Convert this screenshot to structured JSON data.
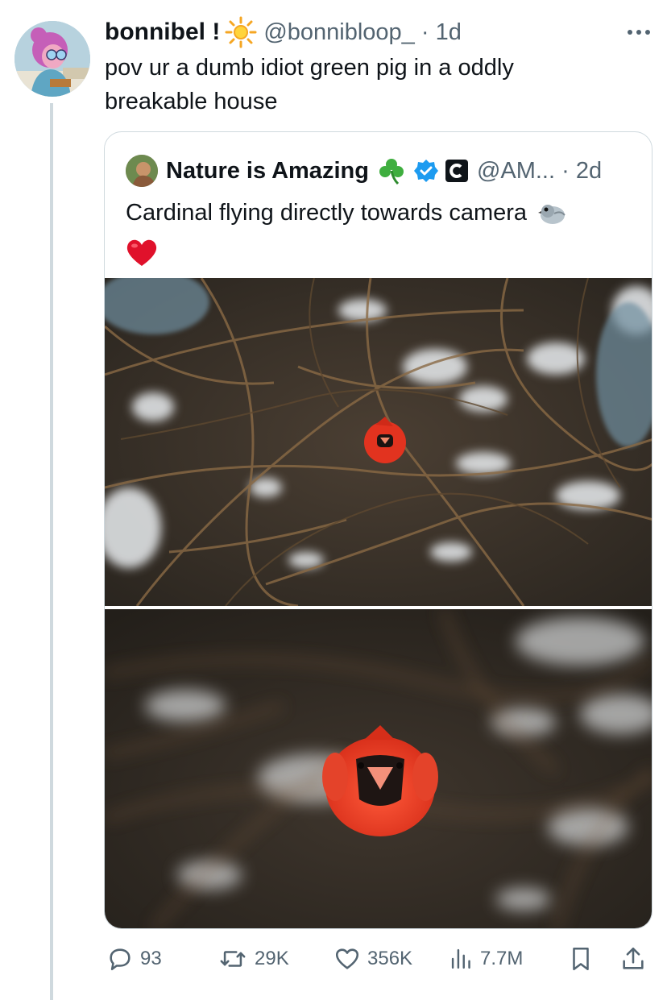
{
  "tweet": {
    "author": {
      "display_name": "bonnibel !",
      "name_emoji": "sun-icon",
      "handle": "@bonnibloop_",
      "time": "1d"
    },
    "text": "pov ur a dumb idiot green pig in a oddly breakable house",
    "more_icon": "more-icon"
  },
  "quote": {
    "author": {
      "display_name": "Nature is Amazing",
      "name_emoji": "shamrock-icon",
      "verified": true,
      "handle": "@AM...",
      "time": "2d"
    },
    "text": "Cardinal flying directly towards camera",
    "emojis": [
      "pigeon-icon",
      "red-heart-icon"
    ],
    "media": [
      {
        "description_icon": "photo-cardinal-distant"
      },
      {
        "description_icon": "photo-cardinal-close"
      }
    ]
  },
  "actions": {
    "replies": "93",
    "retweets": "29K",
    "likes": "356K",
    "views": "7.7M"
  },
  "colors": {
    "text": "#0f1419",
    "secondary": "#536471",
    "border": "#cfd9de",
    "verified": "#1d9bf0",
    "thread_line": "#cfd9de"
  }
}
